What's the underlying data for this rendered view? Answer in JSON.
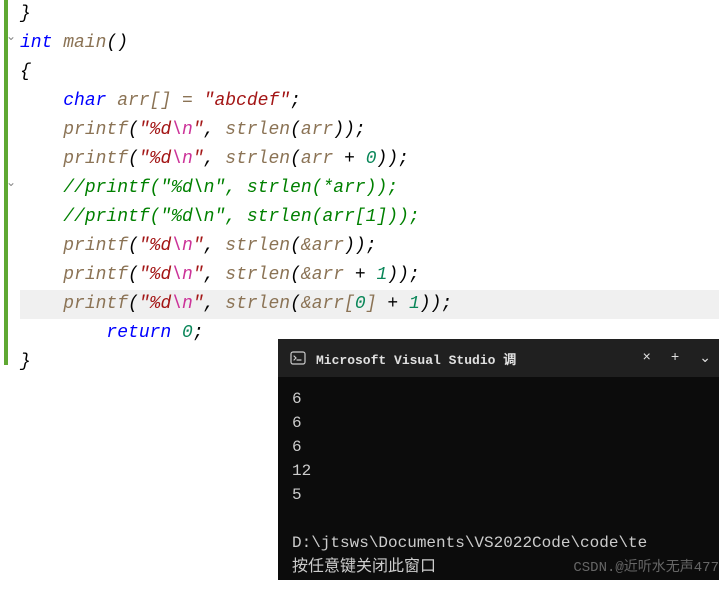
{
  "editor": {
    "lines": {
      "l0": "}",
      "int_kw": "int",
      "main_name": " main",
      "open_brace": "{",
      "char_kw": "char",
      "arr_decl": " arr[] = ",
      "str_literal": "\"abcdef\"",
      "semicolon": ";",
      "printf_name": "printf",
      "fmt_pre": "\"%d",
      "fmt_esc": "\\n",
      "fmt_post": "\"",
      "comma_sp": ", ",
      "strlen_name": "strlen",
      "arr_ident": "arr",
      "plus0": " + ",
      "zero": "0",
      "comment1": "//printf(\"%d\\n\", strlen(*arr));",
      "comment2": "//printf(\"%d\\n\", strlen(arr[1]));",
      "amp_arr": "&arr",
      "amp_arr0": "&arr[",
      "close_bracket": "]",
      "plus1": " + ",
      "one": "1",
      "return_kw": "return",
      "return_val": " 0",
      "close_brace": "}"
    }
  },
  "terminal": {
    "title": "Microsoft Visual Studio 调试控",
    "output": {
      "o1": "6",
      "o2": "6",
      "o3": "6",
      "o4": "12",
      "o5": "5"
    },
    "path": "D:\\jtsws\\Documents\\VS2022Code\\code\\te",
    "prompt": "按任意键关闭此窗口",
    "watermark": "CSDN.@近听水无声477"
  },
  "controls": {
    "close": "×",
    "plus": "+",
    "chevron": "⌄"
  }
}
